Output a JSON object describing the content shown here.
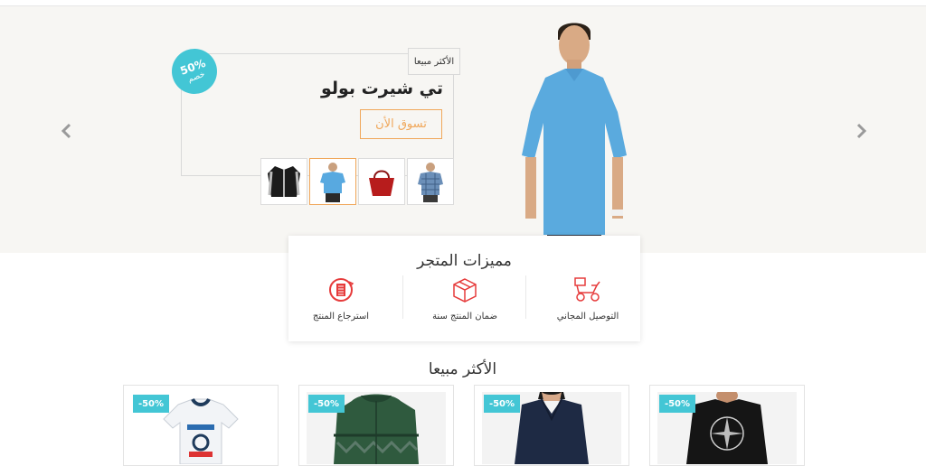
{
  "hero": {
    "tag": "الأكثر مبيعا",
    "discount_percent": "50%",
    "discount_word": "خصم",
    "product_title": "تي شيرت بولو",
    "shop_button": "تسوق الأن",
    "thumbnails": [
      "checkered-shirt",
      "handbag",
      "polo-shirt",
      "jacket"
    ],
    "active_thumbnail": 2
  },
  "features": {
    "title": "مميزات المتجر",
    "items": [
      {
        "label": "التوصيل المجاني",
        "icon": "scooter-icon"
      },
      {
        "label": "ضمان المنتج سنة",
        "icon": "box-icon"
      },
      {
        "label": "استرجاع المنتج",
        "icon": "return-icon"
      }
    ]
  },
  "best_sellers": {
    "title": "الأكثر مبيعا",
    "products": [
      {
        "badge": "-50%",
        "image": "tshirt-kids"
      },
      {
        "badge": "-50%",
        "image": "green-jacket"
      },
      {
        "badge": "-50%",
        "image": "navy-blouse"
      },
      {
        "badge": "-50%",
        "image": "black-tshirt"
      }
    ]
  },
  "colors": {
    "accent_teal": "#43c6d5",
    "accent_orange": "#f0a75a",
    "icon_red": "#e63b3b"
  }
}
